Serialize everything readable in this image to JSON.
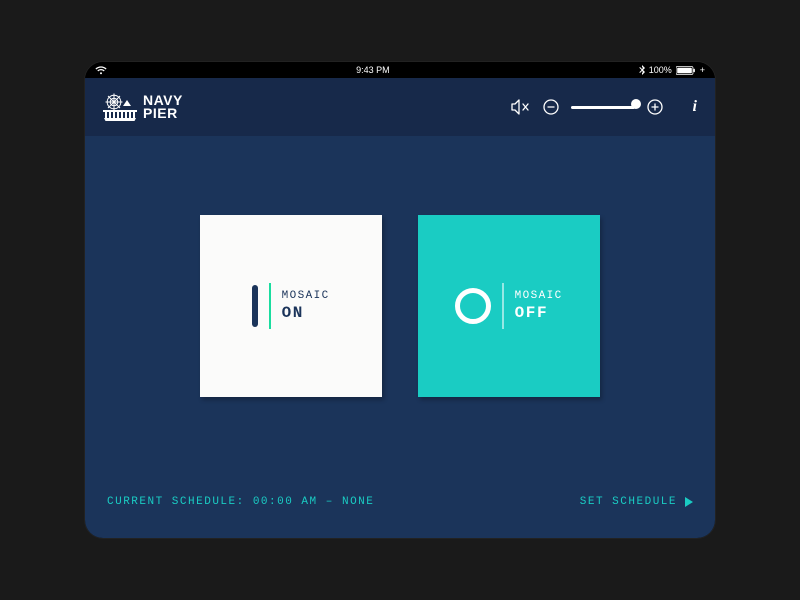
{
  "statusbar": {
    "time": "9:43 PM",
    "battery": "100%"
  },
  "logo": {
    "line1": "NAVY",
    "line2": "PIER"
  },
  "header": {
    "mute_icon": "mute",
    "minus_icon": "minus",
    "plus_icon": "plus",
    "info_icon": "i"
  },
  "tiles": {
    "on": {
      "name": "MOSAIC",
      "state": "ON"
    },
    "off": {
      "name": "MOSAIC",
      "state": "OFF"
    }
  },
  "footer": {
    "schedule_label": "CURRENT SCHEDULE:",
    "schedule_time": "00:00 AM",
    "schedule_sep": "–",
    "schedule_value": "NONE",
    "set_schedule": "SET SCHEDULE"
  }
}
